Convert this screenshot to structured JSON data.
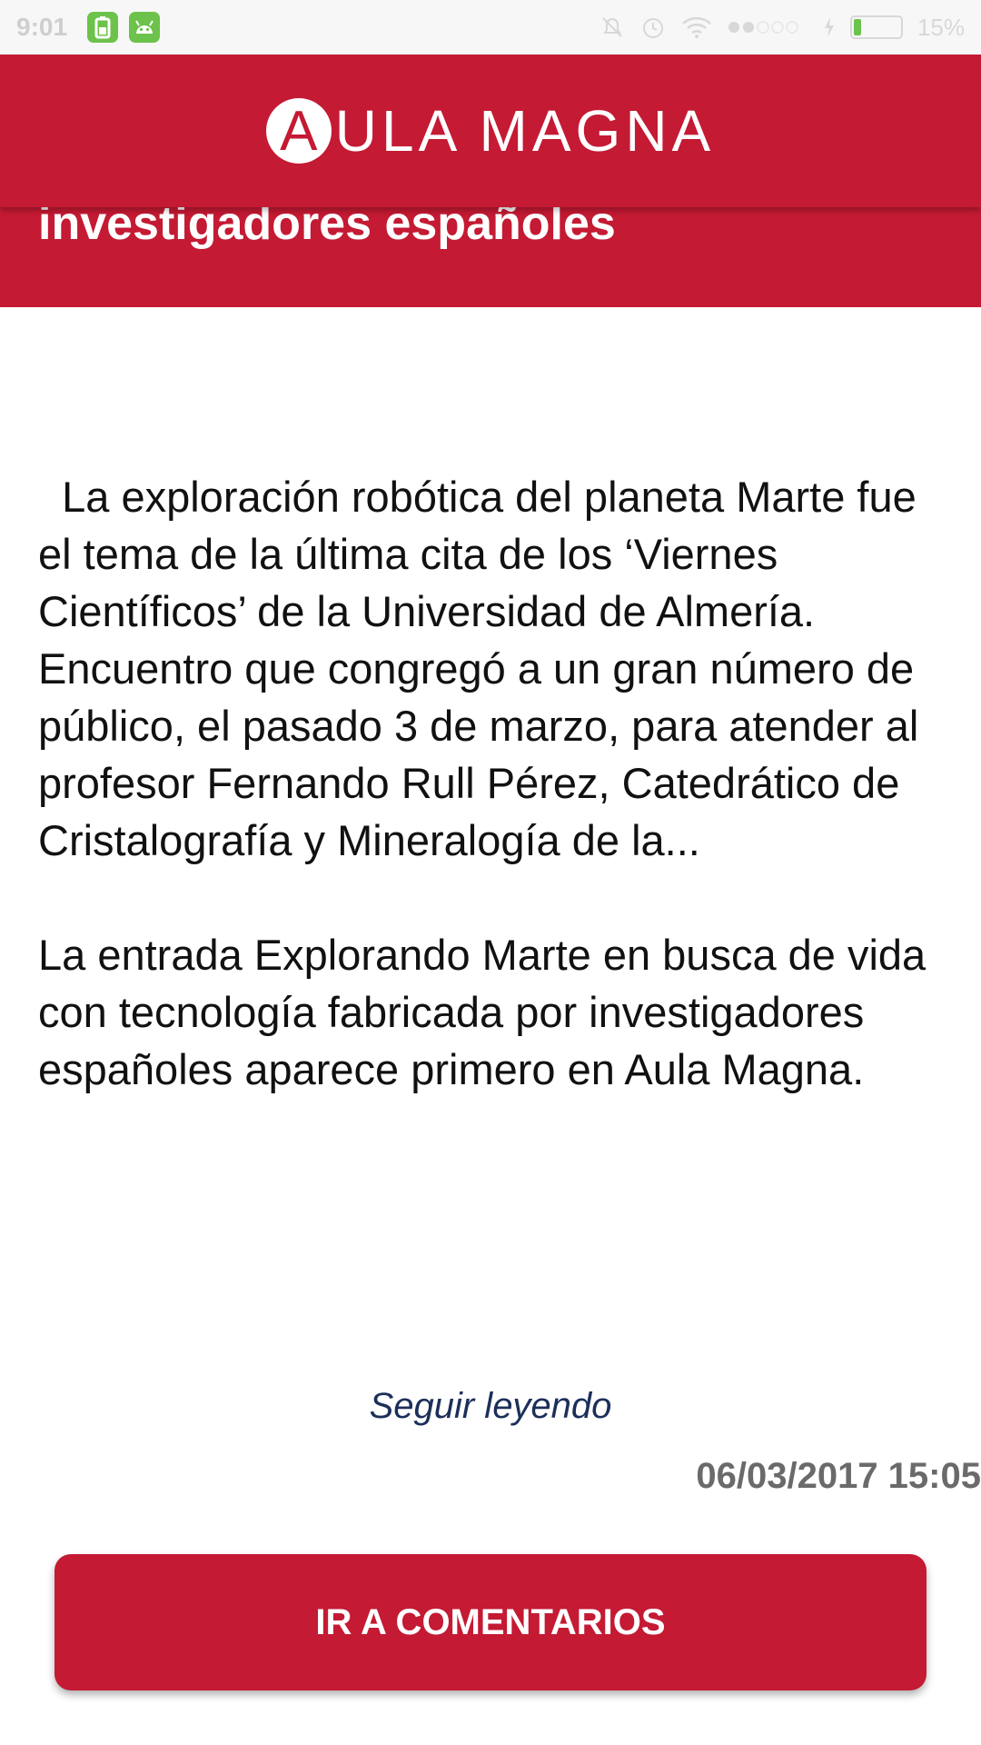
{
  "status_bar": {
    "time": "9:01",
    "battery_percent": "15%",
    "battery_level": 0.15,
    "notification_icons": [
      "battery-saver-icon",
      "android-icon"
    ],
    "system_icons": [
      "alarm-off-icon",
      "alarm-clock-icon",
      "wifi-icon",
      "signal-icon",
      "charging-icon",
      "battery-icon"
    ]
  },
  "header": {
    "logo_letter": "A",
    "logo_text": "ULA MAGNA",
    "brand_color": "#c41a33"
  },
  "article": {
    "title_fragment": "investigadores españoles",
    "paragraphs": [
      "  La exploración robótica del planeta Marte fue el tema de la última cita de los ‘Viernes Científicos’ de la Universidad de Almería. Encuentro que congregó a un gran número de público, el pasado 3 de marzo, para atender al profesor Fernando Rull Pérez, Catedrático de Cristalografía y Mineralogía de la...",
      "La entrada Explorando Marte en busca de vida con tecnología fabricada por investigadores españoles aparece primero en Aula Magna."
    ],
    "read_more": "Seguir leyendo",
    "date": "06/03/2017 15:05"
  },
  "footer": {
    "comments_button": "IR A COMENTARIOS"
  }
}
